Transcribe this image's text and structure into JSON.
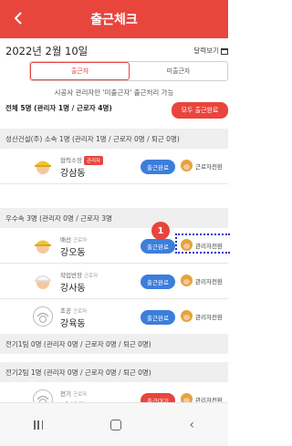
{
  "header": {
    "title": "출근체크",
    "back_icon": "chevron-left-icon"
  },
  "date_bar": {
    "date": "2022년 2월 10일",
    "calendar_label": "달력보기"
  },
  "tabs": [
    {
      "label": "출근자",
      "active": true
    },
    {
      "label": "미출근자",
      "active": false
    }
  ],
  "notice": "시공사 관리자만 '미출근자' 출근처리 가능",
  "summary": {
    "text": "전체 5명 (관리자 1명 / 근로자 4명)",
    "all_button": "모두 출근완료"
  },
  "sections": [
    {
      "title": "성산건설(주) 소속 1명 (관리자 1명 / 근로자 0명 / 퇴근 0명)"
    },
    {
      "title": "우수속 3명 (관리자 0명 / 근로자 3명"
    },
    {
      "title": "전기1팀 0명 (관리자 0명 / 근로자 0명 / 퇴근 0명)"
    },
    {
      "title": "전기2팀 1명 (관리자 0명 / 근로자 0명 / 퇴근 0명)"
    }
  ],
  "rows": [
    {
      "role": "협력소장",
      "badge": "관리자",
      "tag": "",
      "name": "강삼동",
      "button": "출근완료",
      "manager": "근로자전환",
      "avatar": "helmet-yellow"
    },
    {
      "role": "배선",
      "tag": "근로자",
      "badge": "",
      "name": "강오동",
      "button": "출근완료",
      "manager": "관리자전환",
      "avatar": "helmet-yellow"
    },
    {
      "role": "작업반장",
      "tag": "근로자",
      "badge": "",
      "name": "강사동",
      "button": "출근완료",
      "manager": "관리자전환",
      "avatar": "helmet-white"
    },
    {
      "role": "조공",
      "tag": "근로자",
      "badge": "",
      "name": "강육동",
      "button": "출근완료",
      "manager": "관리자전환",
      "avatar": "helmet-outline"
    },
    {
      "role": "전기",
      "tag": "근로자",
      "badge": "",
      "name": "장일동",
      "button": "출근대기",
      "manager": "관리자전환",
      "avatar": "helmet-outline"
    }
  ],
  "annotation": {
    "marker": "1"
  },
  "colors": {
    "accent": "#e8453c",
    "blue": "#3d7edb"
  }
}
